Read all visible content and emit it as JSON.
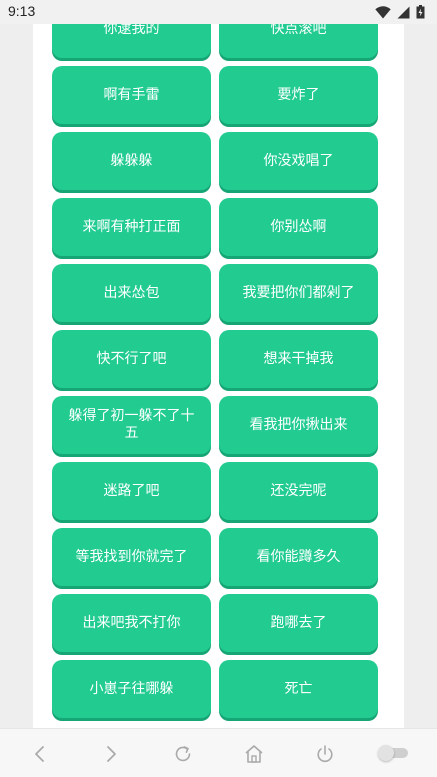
{
  "status_bar": {
    "time": "9:13",
    "icons": [
      "wifi-icon",
      "cellular-signal-icon",
      "battery-icon"
    ]
  },
  "buttons": [
    "你逮我的",
    "快点滚吧",
    "啊有手雷",
    "要炸了",
    "躲躲躲",
    "你没戏唱了",
    "来啊有种打正面",
    "你别怂啊",
    "出来怂包",
    "我要把你们都剁了",
    "快不行了吧",
    "想来干掉我",
    "躲得了初一躲不了十五",
    "看我把你揪出来",
    "迷路了吧",
    "还没完呢",
    "等我找到你就完了",
    "看你能蹲多久",
    "出来吧我不打你",
    "跑哪去了",
    "小崽子往哪躲",
    "死亡"
  ],
  "nav_bar": {
    "icons": [
      "back-icon",
      "forward-icon",
      "refresh-icon",
      "home-icon",
      "power-icon",
      "toggle-switch-icon"
    ],
    "toggle_on": false
  },
  "colors": {
    "button": "#22cc91",
    "button_shadow": "#16a574",
    "panel": "#ffffff",
    "background": "#efefef"
  }
}
